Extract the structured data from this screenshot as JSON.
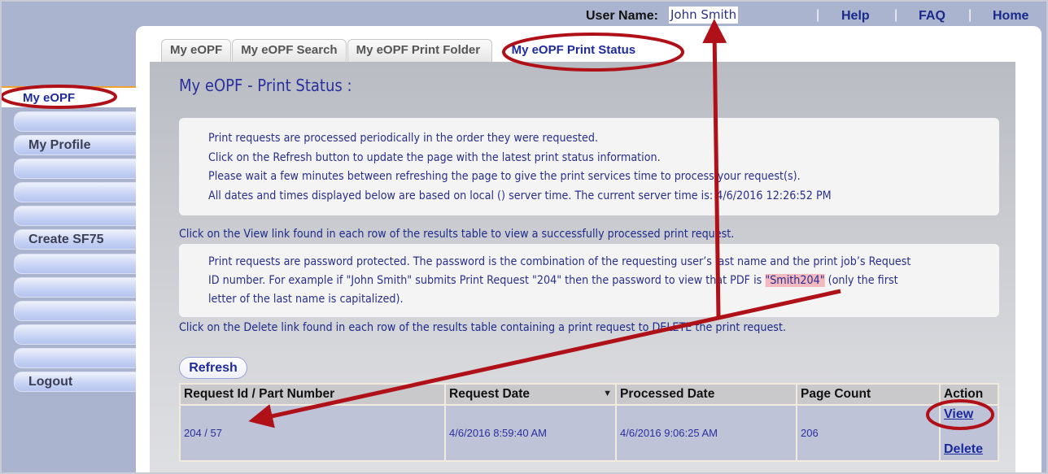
{
  "header": {
    "user_label": "User Name:",
    "user_name": "John Smith",
    "links": [
      "Help",
      "FAQ",
      "Home"
    ],
    "separator": "|"
  },
  "tabs": [
    {
      "label": "My eOPF",
      "active": false
    },
    {
      "label": "My eOPF Search",
      "active": false
    },
    {
      "label": "My eOPF Print Folder",
      "active": false
    },
    {
      "label": "My eOPF Print Status",
      "active": true
    }
  ],
  "sidebar": {
    "selected": "My eOPF",
    "items": [
      "",
      "My Profile",
      "",
      "",
      "",
      "Create SF75",
      "",
      "",
      "",
      "",
      "",
      "Logout"
    ]
  },
  "page": {
    "title": "My eOPF - Print Status :",
    "info_lines": [
      "Print requests are processed periodically in the order they were requested.",
      "Click on the Refresh button to update the page with the latest print status information.",
      "Please wait a few minutes between refreshing the page to give the print services time to process your request(s).",
      "All dates and times displayed below are based on local () server time. The current server time is: 4/6/2016 12:26:52 PM"
    ],
    "view_instruction": "Click on the View link found in each row of the results table to view a successfully processed print request.",
    "password_note": {
      "line1": "Print requests are password protected. The password is the combination of the requesting user’s last name and the print job’s Request",
      "line2_before": "ID number. For example if \"John Smith\" submits Print Request \"204\" then the password to view that PDF is ",
      "line2_highlight": "\"Smith204\"",
      "line2_after": " (only the first",
      "line3": "letter of the last name is capitalized)."
    },
    "delete_instruction": "Click on the Delete link found in each row of the results table containing a print request to DELETE the print request.",
    "refresh_label": "Refresh"
  },
  "table": {
    "columns": [
      "Request Id / Part Number",
      "Request Date",
      "Processed Date",
      "Page Count",
      "Action"
    ],
    "sorted_column": "Request Date",
    "rows": [
      {
        "request_id": "204 / 57",
        "request_date": "4/6/2016 8:59:40 AM",
        "processed_date": "4/6/2016 9:06:25 AM",
        "page_count": "206",
        "actions": [
          "View",
          "Delete"
        ]
      }
    ]
  },
  "colors": {
    "annotation": "#b01018",
    "link": "#1a2a9c",
    "highlight": "#f3b9c0"
  }
}
